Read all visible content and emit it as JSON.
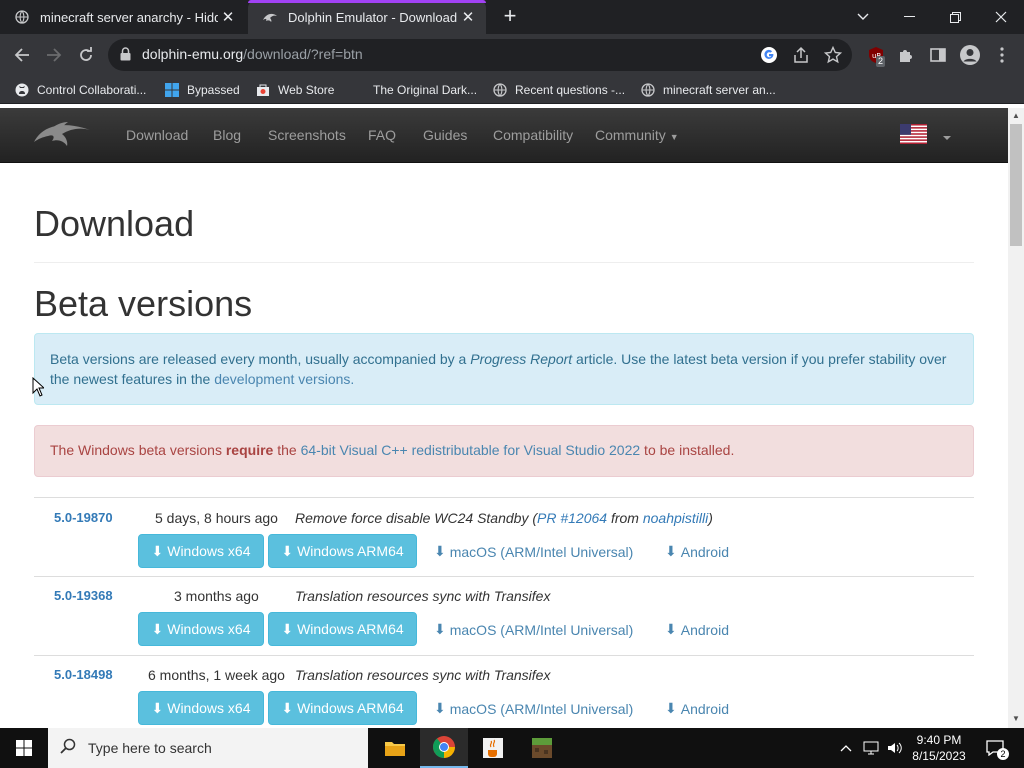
{
  "browser": {
    "tabs": [
      {
        "title": "minecraft server anarchy - Hidde",
        "active": false
      },
      {
        "title": "Dolphin Emulator - Download",
        "active": true
      }
    ],
    "url_domain": "dolphin-emu.org",
    "url_path": "/download/?ref=btn",
    "extension_badge": "2",
    "bookmarks": [
      "Control Collaborati...",
      "Bypassed",
      "Web Store",
      "The Original Dark...",
      "Recent questions -...",
      "minecraft server an..."
    ]
  },
  "site": {
    "nav": [
      "Download",
      "Blog",
      "Screenshots",
      "FAQ",
      "Guides",
      "Compatibility",
      "Community"
    ],
    "heading": "Download",
    "section_heading": "Beta versions",
    "info_part1": "Beta versions are released every month, usually accompanied by a ",
    "info_italic": "Progress Report",
    "info_part2": " article. Use the latest beta version if you prefer stability over",
    "info_part3": "the newest features in the ",
    "info_link": "development versions.",
    "warn_part1": "The Windows beta versions ",
    "warn_bold": "require",
    "warn_part2": " the ",
    "warn_link": "64-bit Visual C++ redistributable for Visual Studio 2022",
    "warn_part3": " to be installed.",
    "releases": [
      {
        "version": "5.0-19870",
        "date": "5 days, 8 hours ago",
        "desc_pre": "Remove force disable WC24 Standby (",
        "pr": "PR #12064",
        "from": " from ",
        "author": "noahpistilli",
        "desc_post": ")"
      },
      {
        "version": "5.0-19368",
        "date": "3 months ago",
        "desc_pre": "Translation resources sync with Transifex",
        "pr": "",
        "from": "",
        "author": "",
        "desc_post": ""
      },
      {
        "version": "5.0-18498",
        "date": "6 months, 1 week ago",
        "desc_pre": "Translation resources sync with Transifex",
        "pr": "",
        "from": "",
        "author": "",
        "desc_post": ""
      }
    ],
    "buttons": {
      "win_x64": "Windows x64",
      "win_arm64": "Windows ARM64",
      "macos": "macOS (ARM/Intel Universal)",
      "android": "Android"
    }
  },
  "taskbar": {
    "search_placeholder": "Type here to search",
    "time": "9:40 PM",
    "date": "8/15/2023",
    "notif_count": "2"
  },
  "colors": {
    "accent_tab": "#a142f4",
    "info_bg": "#d9edf7",
    "danger_bg": "#f2dede",
    "btn_info": "#5bc0de",
    "link": "#337ab7"
  }
}
